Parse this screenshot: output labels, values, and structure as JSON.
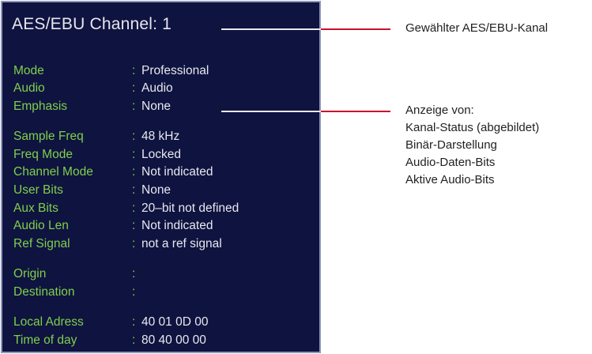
{
  "panel": {
    "title": "AES/EBU Channel: 1",
    "rows": [
      {
        "label": "Mode",
        "value": "Professional"
      },
      {
        "label": "Audio",
        "value": "Audio"
      },
      {
        "label": "Emphasis",
        "value": "None"
      },
      {
        "label": "Sample Freq",
        "value": "48 kHz"
      },
      {
        "label": "Freq Mode",
        "value": "Locked"
      },
      {
        "label": "Channel Mode",
        "value": "Not indicated"
      },
      {
        "label": "User Bits",
        "value": "None"
      },
      {
        "label": "Aux Bits",
        "value": "20–bit not defined"
      },
      {
        "label": "Audio Len",
        "value": "Not indicated"
      },
      {
        "label": "Ref Signal",
        "value": "not a ref signal"
      },
      {
        "label": "Origin",
        "value": ""
      },
      {
        "label": "Destination",
        "value": ""
      },
      {
        "label": "Local Adress",
        "value": "40  01  0D  00"
      },
      {
        "label": "Time of day",
        "value": "80  40  00  00"
      }
    ],
    "separator": ":"
  },
  "annotations": {
    "channel": "Gewählter AES/EBU-Kanal",
    "display": {
      "heading": "Anzeige von:",
      "items": [
        "Kanal-Status (abgebildet)",
        "Binär-Darstellung",
        "Audio-Daten-Bits",
        "Aktive Audio-Bits"
      ]
    }
  },
  "colors": {
    "panel_bg": "#0f1340",
    "label": "#7fd04a",
    "value": "#e8e8ee",
    "callout": "#c8102e"
  }
}
